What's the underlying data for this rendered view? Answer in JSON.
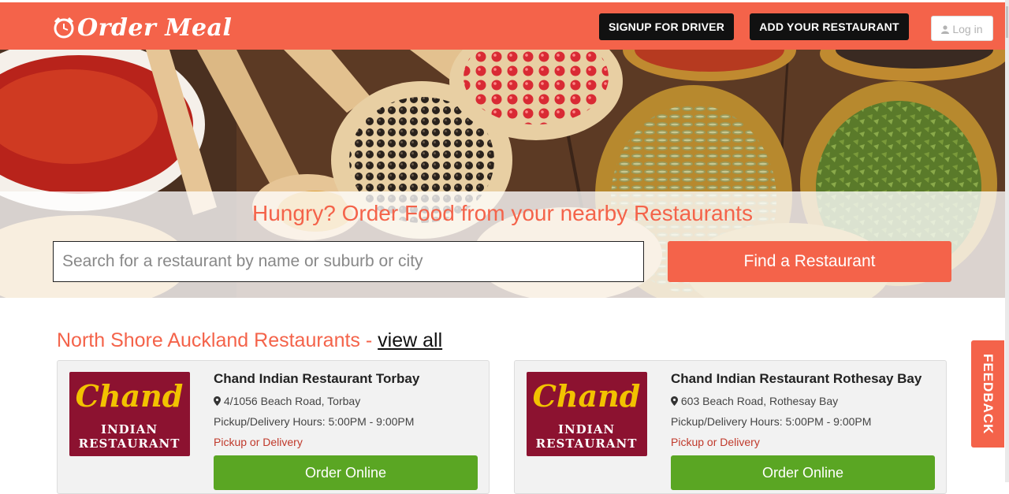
{
  "header": {
    "logo_text": "Order Meal",
    "signup_driver": "SIGNUP FOR DRIVER",
    "add_restaurant": "ADD YOUR RESTAURANT",
    "login": "Log in"
  },
  "hero": {
    "title": "Hungry? Order Food from your nearby Restaurants",
    "search_placeholder": "Search for a restaurant by name or suburb or city",
    "search_value": "",
    "find_button": "Find a Restaurant"
  },
  "section": {
    "title": "North Shore Auckland Restaurants - ",
    "view_all": "view all"
  },
  "restaurants": [
    {
      "name": "Chand Indian Restaurant Torbay",
      "address": "4/1056 Beach Road, Torbay",
      "hours": "Pickup/Delivery Hours: 5:00PM - 9:00PM",
      "mode": "Pickup or Delivery",
      "order_label": "Order Online",
      "logo_word": "Chand",
      "logo_line1": "INDIAN",
      "logo_line2": "RESTAURANT"
    },
    {
      "name": "Chand Indian Restaurant Rothesay Bay",
      "address": "603 Beach Road, Rothesay Bay",
      "hours": "Pickup/Delivery Hours: 5:00PM - 9:00PM",
      "mode": "Pickup or Delivery",
      "order_label": "Order Online",
      "logo_word": "Chand",
      "logo_line1": "INDIAN",
      "logo_line2": "RESTAURANT"
    }
  ],
  "feedback_label": "FEEDBACK",
  "colors": {
    "brand": "#f4634a",
    "order_button": "#5aa623",
    "logo_bg": "#8c1230",
    "logo_gold": "#f2c200"
  },
  "icons": {
    "logo": "alarm-clock-icon",
    "login": "user-icon",
    "address": "map-marker-icon"
  }
}
